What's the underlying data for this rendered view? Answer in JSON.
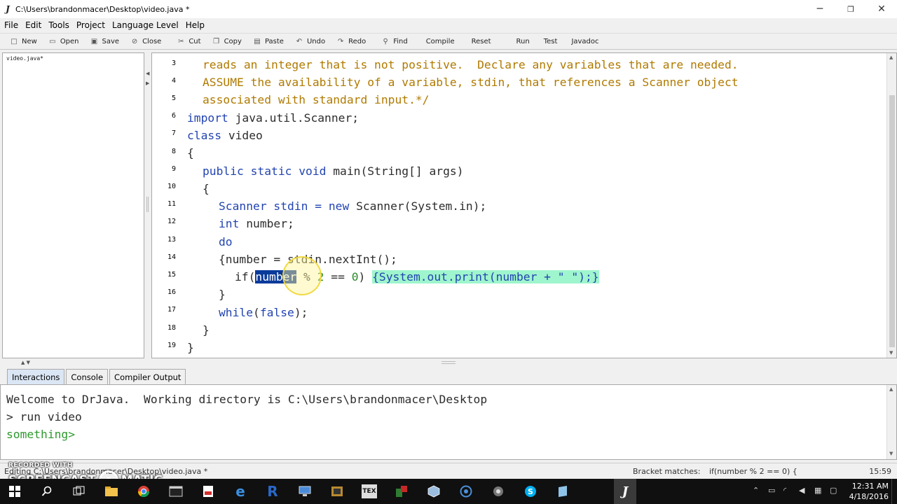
{
  "window": {
    "title": "C:\\Users\\brandonmacer\\Desktop\\video.java *",
    "controls": {
      "minimize": "─",
      "restore": "❐",
      "close": "✕"
    }
  },
  "menu": [
    "File",
    "Edit",
    "Tools",
    "Project",
    "Language Level",
    "Help"
  ],
  "toolbar": [
    {
      "label": "New",
      "icon": "new-file-icon",
      "glyph": "□"
    },
    {
      "label": "Open",
      "icon": "open-folder-icon",
      "glyph": "▭"
    },
    {
      "label": "Save",
      "icon": "save-disk-icon",
      "glyph": "▣"
    },
    {
      "label": "Close",
      "icon": "close-file-icon",
      "glyph": "⊘"
    },
    {
      "label": "Cut",
      "icon": "scissors-icon",
      "glyph": "✂"
    },
    {
      "label": "Copy",
      "icon": "copy-icon",
      "glyph": "❐"
    },
    {
      "label": "Paste",
      "icon": "paste-clipboard-icon",
      "glyph": "▤"
    },
    {
      "label": "Undo",
      "icon": "undo-arrow-icon",
      "glyph": "↶"
    },
    {
      "label": "Redo",
      "icon": "redo-arrow-icon",
      "glyph": "↷"
    },
    {
      "label": "Find",
      "icon": "binoculars-icon",
      "glyph": "⚲"
    },
    {
      "label": "Compile"
    },
    {
      "label": "Reset"
    },
    {
      "label": "Run"
    },
    {
      "label": "Test"
    },
    {
      "label": "Javadoc"
    }
  ],
  "files": [
    "video.java*"
  ],
  "editor": {
    "line_numbers": [
      "3",
      "4",
      "5",
      "6",
      "7",
      "8",
      "9",
      "10",
      "11",
      "12",
      "13",
      "14",
      "15",
      "16",
      "17",
      "18",
      "19"
    ],
    "lines": {
      "l3": "reads an integer that is not positive.  Declare any variables that are needed.",
      "l4": "ASSUME the availability of a variable, stdin, that references a Scanner object",
      "l5": "associated with standard input.*/",
      "l6a": "import",
      "l6b": " java.util.Scanner;",
      "l7a": "class",
      "l7b": " video",
      "l8": "{",
      "l9a": "public static void",
      "l9b": " main(String[] args)",
      "l10": "{",
      "l11a": "Scanner stdin = ",
      "l11b": "new",
      "l11c": " Scanner(System.in);",
      "l12a": "int",
      "l12b": " number;",
      "l13": "do",
      "l14": "{number = stdin.nextInt();",
      "l15a": "if(",
      "l15b": "number",
      "l15c": " % ",
      "l15d": "2",
      "l15e": " == ",
      "l15f": "0",
      "l15g": ") ",
      "l15h": "{System.out.print(number + \" \");}",
      "l16": "}",
      "l17a": "while",
      "l17b": "(",
      "l17c": "false",
      "l17d": ");",
      "l18": "}",
      "l19": "}"
    }
  },
  "tabs": [
    "Interactions",
    "Console",
    "Compiler Output"
  ],
  "interactions": {
    "welcome": "Welcome to DrJava.  Working directory is C:\\Users\\brandonmacer\\Desktop",
    "cmd": "> run video",
    "prompt": "something>"
  },
  "status": {
    "file": "Editing C:\\Users\\brandonmacer\\Desktop\\video.java *",
    "bracket_label": "Bracket matches:",
    "bracket_value": "if(number % 2 == 0) {",
    "position": "15:59"
  },
  "watermark": {
    "line1": "RECORDED WITH",
    "line2a": "SCREENCAST",
    "line2b": "MATIC"
  },
  "taskbar": {
    "time": "12:31 AM",
    "date": "4/18/2016",
    "apps": [
      "windows-start-icon",
      "search-icon",
      "task-view-icon",
      "file-explorer-icon",
      "chrome-icon",
      "terminal-icon",
      "pdf-icon",
      "edge-icon",
      "r-icon",
      "network-icon",
      "app-icon",
      "latex-icon",
      "app-icon",
      "cube-icon",
      "circle-app-icon",
      "tool-icon",
      "skype-icon",
      "notepad-icon",
      "drjava-icon"
    ]
  },
  "colors": {
    "comment": "#b07a00",
    "keyword": "#2244b0",
    "selection": "#0a3a9a",
    "brace_match": "#9ff5cd",
    "prompt_green": "#2e9a2e"
  }
}
